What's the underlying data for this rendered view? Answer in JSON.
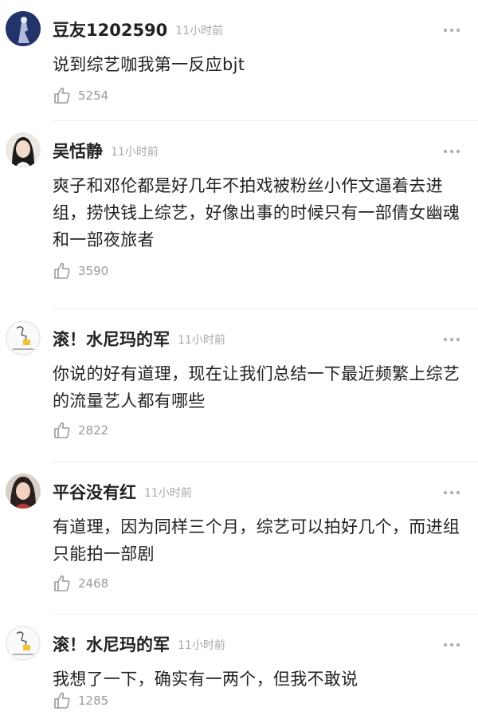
{
  "comments": [
    {
      "username": "豆友1202590",
      "time": "11小时前",
      "text": "说到综艺咖我第一反应bjt",
      "likes": "5254",
      "avatar": "dark-blue-figure-avatar"
    },
    {
      "username": "吴恬静",
      "time": "11小时前",
      "text": "爽子和邓伦都是好几年不拍戏被粉丝小作文逼着去进组，捞快钱上综艺，好像出事的时候只有一部倩女幽魂和一部夜旅者",
      "likes": "3590",
      "avatar": "woman-portrait-avatar"
    },
    {
      "username": "滚！水尼玛的军",
      "time": "11小时前",
      "text": "你说的好有道理，现在让我们总结一下最近频繁上综艺的流量艺人都有哪些",
      "likes": "2822",
      "avatar": "cartoon-sketch-avatar"
    },
    {
      "username": "平谷没有红",
      "time": "11小时前",
      "text": "有道理，因为同样三个月，综艺可以拍好几个，而进组只能拍一部剧",
      "likes": "2468",
      "avatar": "woman-portrait-avatar"
    },
    {
      "username": "滚！水尼玛的军",
      "time": "11小时前",
      "text": "我想了一下，确实有一两个，但我不敢说",
      "likes": "1285",
      "avatar": "cartoon-sketch-avatar"
    }
  ],
  "icons": {
    "like": "thumbs-up-icon",
    "more": "more-dots-icon"
  },
  "colors": {
    "username": "#222222",
    "meta": "#a8a8a8",
    "likes": "#9a9a9a",
    "divider": "#ececec"
  }
}
